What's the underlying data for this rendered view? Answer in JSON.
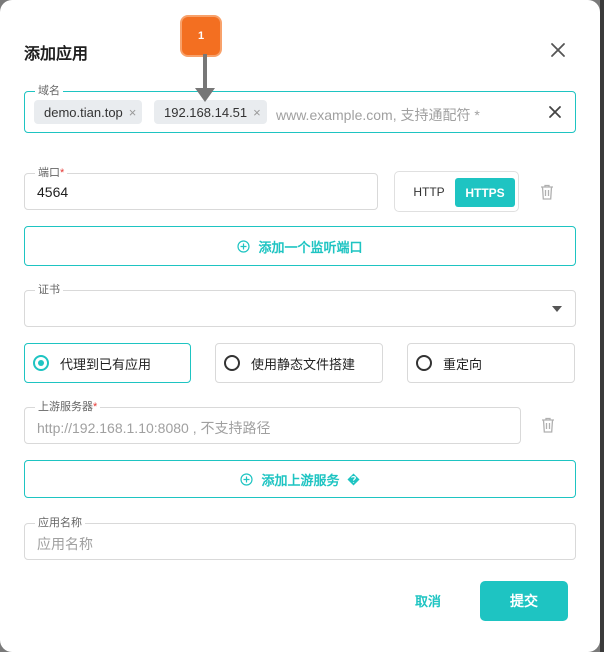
{
  "dialog": {
    "title": "添加应用",
    "close_icon": "close-icon"
  },
  "domain": {
    "label": "域名",
    "chips": [
      "demo.tian.top",
      "192.168.14.51"
    ],
    "chip_remove": "×",
    "placeholder": "www.example.com, 支持通配符 *",
    "clear_icon": "close-icon"
  },
  "port": {
    "label": "端口",
    "required_mark": "*",
    "value": "4564",
    "protocol_options": [
      "HTTP",
      "HTTPS"
    ],
    "selected_protocol": "HTTPS"
  },
  "add_port_button": "添加一个监听端口",
  "certificate": {
    "label": "证书",
    "value": ""
  },
  "mode_options": [
    {
      "label": "代理到已有应用",
      "selected": true
    },
    {
      "label": "使用静态文件搭建",
      "selected": false
    },
    {
      "label": "重定向",
      "selected": false
    }
  ],
  "upstream": {
    "label": "上游服务器",
    "required_mark": "*",
    "placeholder": "http://192.168.1.10:8080 , 不支持路径"
  },
  "add_upstream_button": "添加上游服务",
  "app_name": {
    "label": "应用名称",
    "placeholder": "应用名称"
  },
  "footer": {
    "cancel": "取消",
    "submit": "提交"
  },
  "annotation": {
    "badge": "1"
  },
  "colors": {
    "accent": "#1ec4c2",
    "annotation": "#f36f21"
  }
}
